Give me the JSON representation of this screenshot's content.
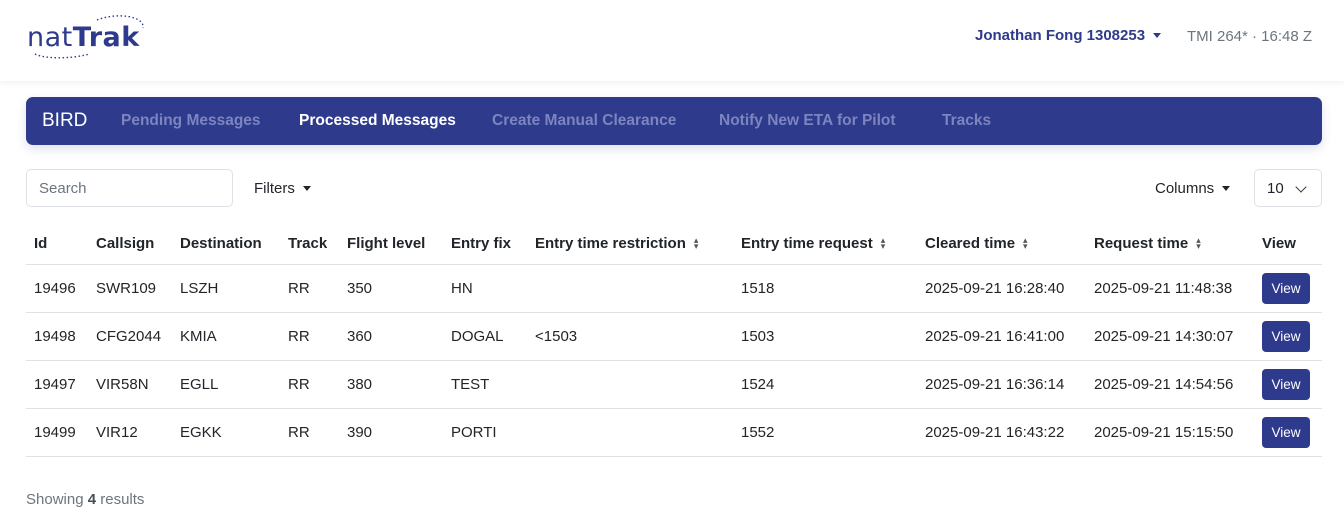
{
  "header": {
    "logo_text_light": "nat",
    "logo_text_bold": "Trak",
    "user": "Jonathan Fong 1308253",
    "tmi": "TMI 264* · 16:48 Z"
  },
  "nav": {
    "brand": "BIRD",
    "items": [
      {
        "label": "Pending Messages",
        "active": false
      },
      {
        "label": "Processed Messages",
        "active": true
      },
      {
        "label": "Create Manual Clearance",
        "active": false
      },
      {
        "label": "Notify New ETA for Pilot",
        "active": false
      },
      {
        "label": "Tracks",
        "active": false
      }
    ]
  },
  "toolbar": {
    "search_placeholder": "Search",
    "filters_label": "Filters",
    "columns_label": "Columns",
    "page_size": "10"
  },
  "table": {
    "headers": [
      "Id",
      "Callsign",
      "Destination",
      "Track",
      "Flight level",
      "Entry fix",
      "Entry time restriction",
      "Entry time request",
      "Cleared time",
      "Request time",
      "View"
    ],
    "rows": [
      [
        "19496",
        "SWR109",
        "LSZH",
        "RR",
        "350",
        "HN",
        "",
        "1518",
        "2025-09-21 16:28:40",
        "2025-09-21 11:48:38",
        "View"
      ],
      [
        "19498",
        "CFG2044",
        "KMIA",
        "RR",
        "360",
        "DOGAL",
        "<1503",
        "1503",
        "2025-09-21 16:41:00",
        "2025-09-21 14:30:07",
        "View"
      ],
      [
        "19497",
        "VIR58N",
        "EGLL",
        "RR",
        "380",
        "TEST",
        "",
        "1524",
        "2025-09-21 16:36:14",
        "2025-09-21 14:54:56",
        "View"
      ],
      [
        "19499",
        "VIR12",
        "EGKK",
        "RR",
        "390",
        "PORTI",
        "",
        "1552",
        "2025-09-21 16:43:22",
        "2025-09-21 15:15:50",
        "View"
      ]
    ]
  },
  "footer": {
    "showing_prefix": "Showing",
    "count": "4",
    "showing_suffix": "results"
  },
  "colors": {
    "brand": "#2e3a8c",
    "nav_inactive": "#7c85bf",
    "muted": "#6c757d",
    "border": "#dee2e6"
  }
}
